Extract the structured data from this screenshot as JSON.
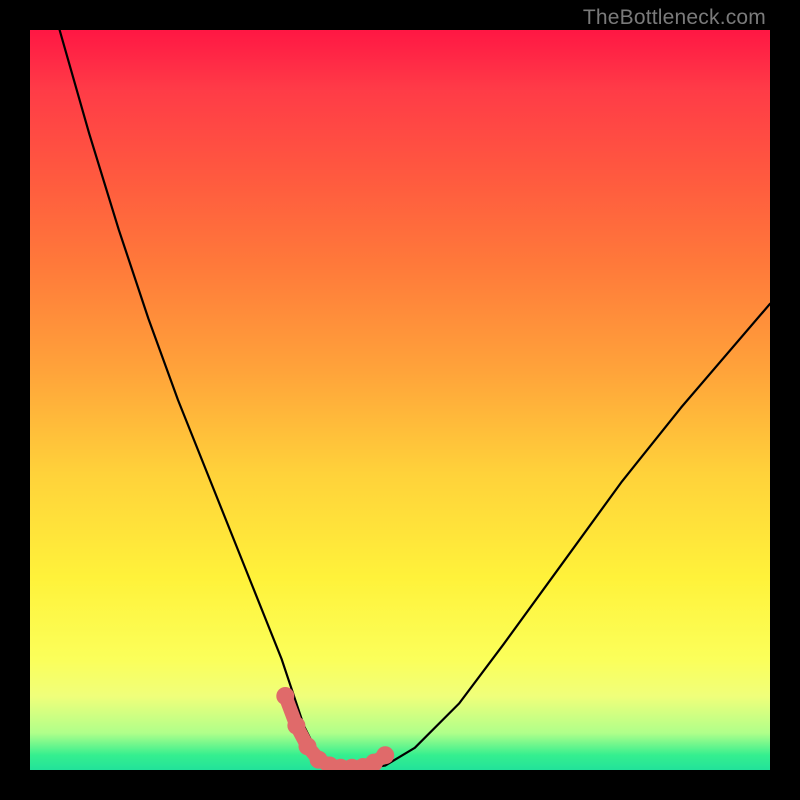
{
  "watermark": {
    "text": "TheBottleneck.com"
  },
  "chart_data": {
    "type": "line",
    "title": "",
    "xlabel": "",
    "ylabel": "",
    "xlim": [
      0,
      100
    ],
    "ylim": [
      0,
      100
    ],
    "grid": false,
    "legend": false,
    "series": [
      {
        "name": "bottleneck-curve",
        "x": [
          4,
          8,
          12,
          16,
          20,
          24,
          28,
          30,
          32,
          34,
          35,
          36,
          37,
          38,
          39,
          40,
          41,
          42,
          43,
          44,
          45,
          46,
          48,
          52,
          58,
          64,
          72,
          80,
          88,
          100
        ],
        "y": [
          100,
          86,
          73,
          61,
          50,
          40,
          30,
          25,
          20,
          15,
          12,
          9,
          6,
          4,
          2,
          1,
          0.5,
          0.3,
          0.2,
          0.2,
          0.2,
          0.3,
          0.6,
          3,
          9,
          17,
          28,
          39,
          49,
          63
        ]
      }
    ],
    "marker_segment": {
      "name": "valley-markers",
      "color": "#e06a6a",
      "x": [
        34.5,
        36,
        37.5,
        39,
        40.5,
        42,
        43.5,
        45,
        46.5,
        48
      ],
      "y": [
        10,
        6,
        3.2,
        1.4,
        0.6,
        0.3,
        0.3,
        0.4,
        1.0,
        2.0
      ]
    },
    "gradient_stops": [
      {
        "pos": 0,
        "color": "#ff1744"
      },
      {
        "pos": 50,
        "color": "#ffcf3a"
      },
      {
        "pos": 85,
        "color": "#fbff5a"
      },
      {
        "pos": 100,
        "color": "#22e29a"
      }
    ]
  }
}
